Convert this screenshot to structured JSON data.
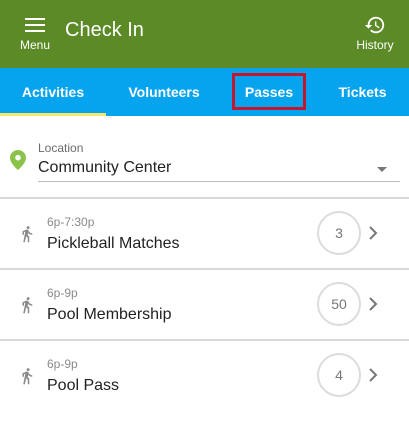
{
  "header": {
    "menu_label": "Menu",
    "title": "Check In",
    "history_label": "History",
    "bg_color": "#5b8a27"
  },
  "tabs": [
    {
      "label": "Activities",
      "active": true
    },
    {
      "label": "Volunteers",
      "active": false
    },
    {
      "label": "Passes",
      "active": false,
      "highlighted": true
    },
    {
      "label": "Tickets",
      "active": false
    }
  ],
  "tab_colors": {
    "bar": "#06a3ee",
    "active_underline": "#f5e76b",
    "highlight_border": "#c2172e"
  },
  "location": {
    "label": "Location",
    "value": "Community Center",
    "icon": "map-pin-icon",
    "icon_color": "#8bc34a"
  },
  "activities": [
    {
      "time": "6p-7:30p",
      "name": "Pickleball Matches",
      "count": "3",
      "icon": "runner-icon"
    },
    {
      "time": "6p-9p",
      "name": "Pool Membership",
      "count": "50",
      "icon": "runner-icon"
    },
    {
      "time": "6p-9p",
      "name": "Pool Pass",
      "count": "4",
      "icon": "runner-icon"
    }
  ]
}
